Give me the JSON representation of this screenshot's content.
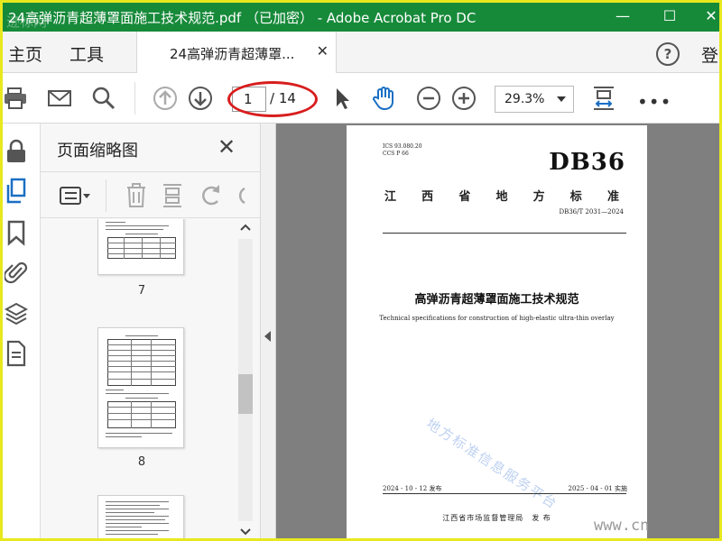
{
  "window": {
    "title": "24高弹沥青超薄罩面施工技术规范.pdf （已加密） - Adobe Acrobat Pro DC",
    "overlay_text": "迹标网",
    "controls": {
      "minimize": "—",
      "maximize": "☐",
      "close": "✕"
    },
    "colors": {
      "titlebar": "#178a3a",
      "frame": "#e8e81e"
    }
  },
  "tabs": {
    "home": "主页",
    "tools": "工具",
    "document": "24高弹沥青超薄罩...",
    "close": "✕",
    "help": "?",
    "sign_in": "登"
  },
  "toolbar": {
    "icons": [
      "print-icon",
      "email-icon",
      "search-icon",
      "prev-page-icon",
      "next-page-icon",
      "select-cursor-icon",
      "hand-tool-icon",
      "zoom-out-icon",
      "zoom-in-icon",
      "fit-page-icon",
      "more-icon"
    ],
    "current_page": "1",
    "total_pages": "/ 14",
    "zoom": "29.3%",
    "more": "•••",
    "highlight_color": "#d81d1d"
  },
  "left_rail": {
    "icons": [
      "lock-icon",
      "pages-icon",
      "bookmark-icon",
      "attachment-icon",
      "layers-icon",
      "content-icon"
    ]
  },
  "thumbnails_panel": {
    "title": "页面缩略图",
    "close": "✕",
    "tools": [
      "thumbnail-options-icon",
      "delete-icon",
      "insert-page-icon",
      "rotate-icon"
    ],
    "pages": [
      {
        "number": "7"
      },
      {
        "number": "8"
      }
    ]
  },
  "document_page": {
    "ics": "ICS 93.080.20",
    "ccs": "CCS P 66",
    "code": "DB36",
    "province_chars": [
      "江",
      "西",
      "省",
      "地",
      "方",
      "标",
      "准"
    ],
    "standard_number": "DB36/T 2031—2024",
    "title_cn": "高弹沥青超薄罩面施工技术规范",
    "title_en": "Technical specifications for construction of high-elastic ultra-thin overlay",
    "watermark": "地方标准信息服务平台",
    "publish_date": "2024 - 10 - 12 发布",
    "effective_date": "2025 - 04 - 01 实施",
    "issuer": "江西省市场监督管理局　发 布"
  },
  "site_watermark": "www.cn"
}
